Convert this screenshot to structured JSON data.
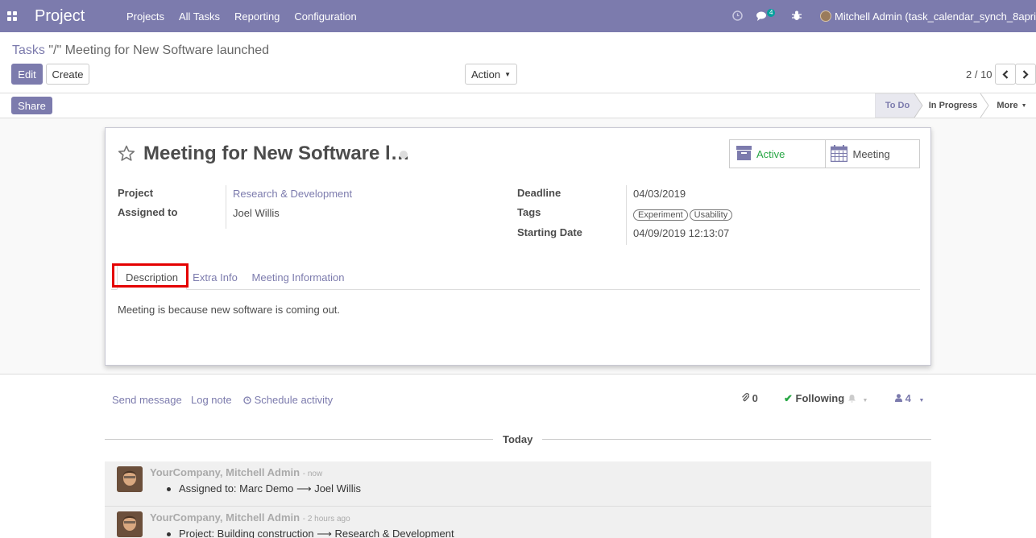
{
  "navbar": {
    "app_name": "Project",
    "menu": [
      "Projects",
      "All Tasks",
      "Reporting",
      "Configuration"
    ],
    "messages_badge": "4",
    "user": "Mitchell Admin (task_calendar_synch_8april)",
    "icons": [
      "apps-icon",
      "clock-icon",
      "chat-icon",
      "bug-icon"
    ]
  },
  "breadcrumb": {
    "parent": "Tasks",
    "separator": " \"/\" ",
    "current": "Meeting for New Software launched"
  },
  "toolbar": {
    "edit": "Edit",
    "create": "Create",
    "action": "Action",
    "pager": "2 / 10"
  },
  "statusbar": {
    "share": "Share",
    "stages": [
      "To Do",
      "In Progress",
      "More"
    ],
    "current_stage": "To Do"
  },
  "form": {
    "title": "Meeting for New Software l…",
    "smart_buttons": {
      "active": "Active",
      "meeting": "Meeting"
    },
    "fields_left": [
      {
        "label": "Project",
        "value": "Research & Development"
      },
      {
        "label": "Assigned to",
        "value": "Joel Willis"
      }
    ],
    "fields_right": [
      {
        "label": "Deadline",
        "value": "04/03/2019"
      },
      {
        "label": "Tags",
        "tags": [
          "Experiment",
          "Usability"
        ]
      },
      {
        "label": "Starting Date",
        "value": "04/09/2019 12:13:07"
      }
    ],
    "tabs": [
      "Description",
      "Extra Info",
      "Meeting Information"
    ],
    "active_tab": "Description",
    "description": "Meeting is because new software is coming out."
  },
  "chatter": {
    "send_message": "Send message",
    "log_note": "Log note",
    "schedule_activity": "Schedule activity",
    "attachments_count": "0",
    "following": "Following",
    "followers_count": "4",
    "date_separator": "Today",
    "messages": [
      {
        "author": "YourCompany, Mitchell Admin",
        "date": "- now",
        "body": "Assigned to: Marc Demo ⟶ Joel Willis"
      },
      {
        "author": "YourCompany, Mitchell Admin",
        "date": "- 2 hours ago",
        "body": "Project: Building construction ⟶ Research & Development"
      }
    ]
  },
  "colors": {
    "brand": "#7c7bad",
    "highlight": "#e40000",
    "active_green": "#28a745"
  }
}
